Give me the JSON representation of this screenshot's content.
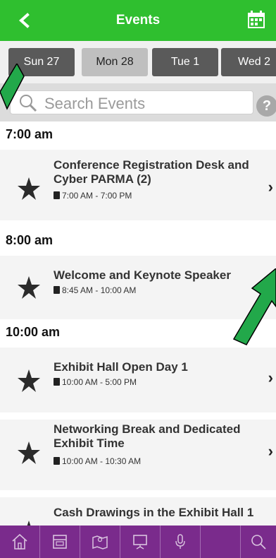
{
  "header": {
    "title": "Events",
    "back_icon": "chevron-left-icon",
    "calendar_icon": "calendar-icon",
    "color": "#2fbf2f"
  },
  "dates": [
    {
      "label": "Sun 27",
      "selected": false
    },
    {
      "label": "Mon 28",
      "selected": true
    },
    {
      "label": "Tue 1",
      "selected": false
    },
    {
      "label": "Wed 2",
      "selected": false
    }
  ],
  "search": {
    "placeholder": "Search Events",
    "help_label": "?"
  },
  "sections": [
    {
      "time": "7:00 am",
      "events": [
        {
          "title": "Conference Registration Desk and Cyber PARMA (2)",
          "time": "7:00 AM - 7:00 PM",
          "has_chevron": true
        }
      ]
    },
    {
      "time": "8:00 am",
      "events": [
        {
          "title": "Welcome and Keynote Speaker",
          "time": "8:45 AM - 10:00 AM",
          "has_chevron": false
        }
      ]
    },
    {
      "time": "10:00 am",
      "events": [
        {
          "title": "Exhibit Hall Open Day 1",
          "time": "10:00 AM - 5:00 PM",
          "has_chevron": true
        },
        {
          "title": "Networking Break and Dedicated Exhibit Time",
          "time": "10:00 AM - 10:30 AM",
          "has_chevron": true
        },
        {
          "title": "Cash Drawings in the Exhibit Hall 1",
          "time": "",
          "has_chevron": false
        }
      ]
    }
  ],
  "bottom_nav": {
    "color": "#7a2b8c",
    "icons": [
      "home-icon",
      "exhibitors-icon",
      "map-icon",
      "presentation-icon",
      "microphone-icon",
      "search-icon"
    ]
  },
  "arrow_color": "#22a84a"
}
